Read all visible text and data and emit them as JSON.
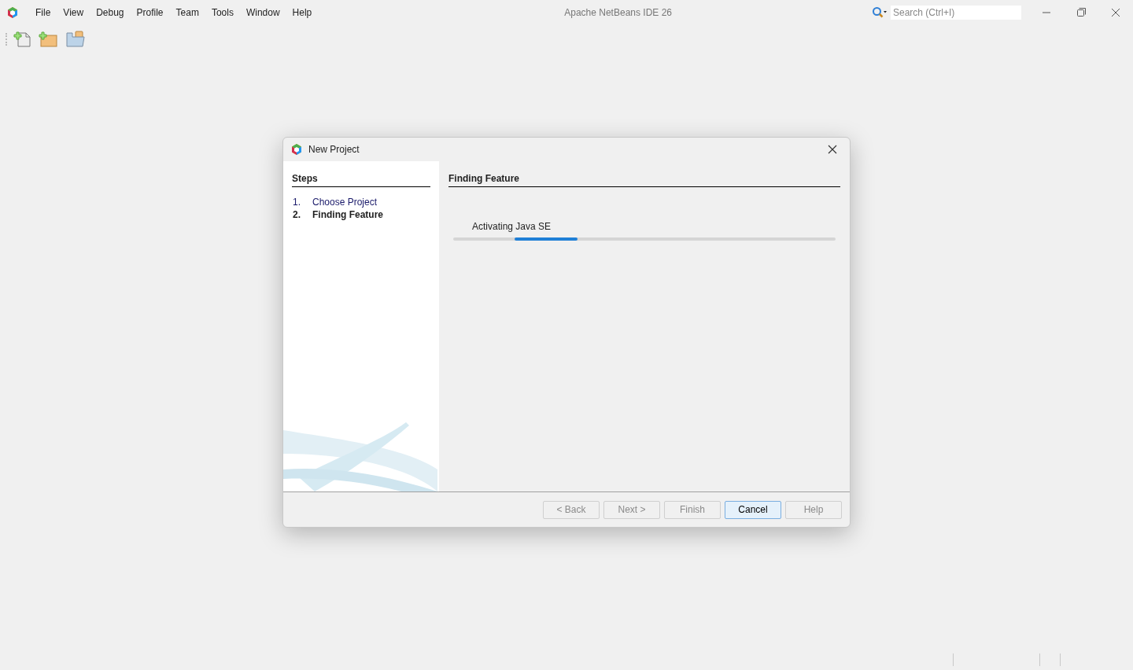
{
  "menu": [
    "File",
    "View",
    "Debug",
    "Profile",
    "Team",
    "Tools",
    "Window",
    "Help"
  ],
  "window": {
    "title": "Apache NetBeans IDE 26"
  },
  "search": {
    "placeholder": "Search (Ctrl+I)"
  },
  "dialog": {
    "title": "New Project",
    "steps_heading": "Steps",
    "steps": [
      {
        "number": "1.",
        "label": "Choose Project",
        "selected": false
      },
      {
        "number": "2.",
        "label": "Finding Feature",
        "selected": true
      }
    ],
    "panel_heading": "Finding Feature",
    "progress": {
      "label": "Activating Java SE",
      "indeterminate": true
    },
    "buttons": [
      {
        "label": "< Back",
        "disabled": true,
        "default": false
      },
      {
        "label": "Next >",
        "disabled": true,
        "default": false
      },
      {
        "label": "Finish",
        "disabled": true,
        "default": false
      },
      {
        "label": "Cancel",
        "disabled": false,
        "default": true
      },
      {
        "label": "Help",
        "disabled": true,
        "default": false
      }
    ]
  }
}
